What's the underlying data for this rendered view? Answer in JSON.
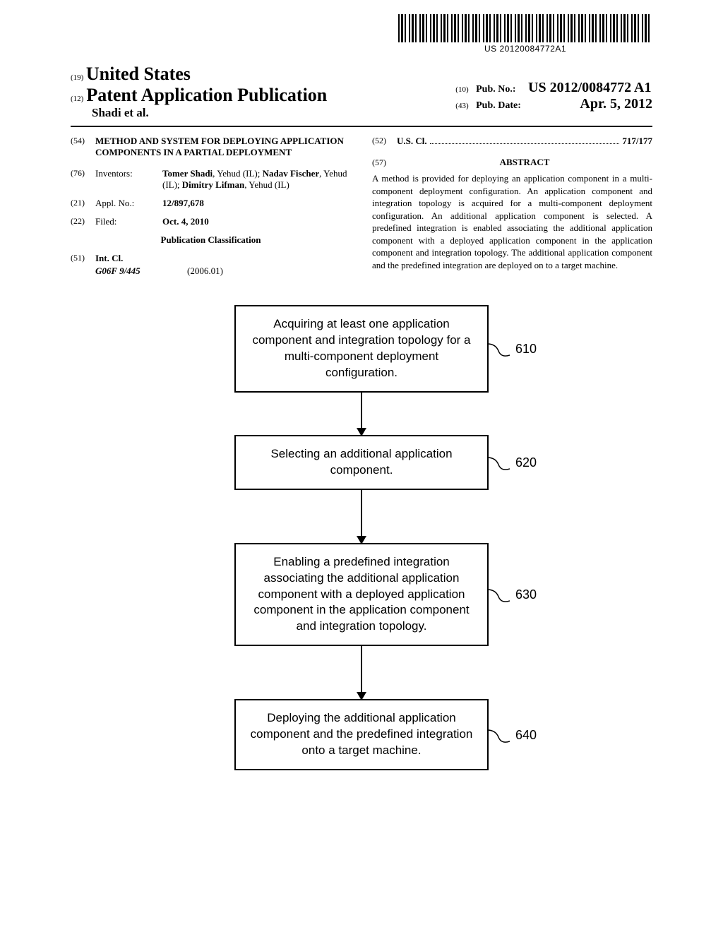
{
  "barcode_number": "US 20120084772A1",
  "header": {
    "code19": "(19)",
    "country": "United States",
    "code12": "(12)",
    "pub_type": "Patent Application Publication",
    "authors": "Shadi et al."
  },
  "right_header": {
    "code10": "(10)",
    "pub_no_label": "Pub. No.:",
    "pub_no_value": "US 2012/0084772 A1",
    "code43": "(43)",
    "pub_date_label": "Pub. Date:",
    "pub_date_value": "Apr. 5, 2012"
  },
  "left_col": {
    "code54": "(54)",
    "title": "METHOD AND SYSTEM FOR DEPLOYING APPLICATION COMPONENTS IN A PARTIAL DEPLOYMENT",
    "code76": "(76)",
    "inventors_label": "Inventors:",
    "inventors_value_1": "Tomer Shadi",
    "inventors_loc_1": ", Yehud (IL); ",
    "inventors_value_2": "Nadav Fischer",
    "inventors_loc_2": ", Yehud (IL); ",
    "inventors_value_3": "Dimitry Lifman",
    "inventors_loc_3": ", Yehud (IL)",
    "code21": "(21)",
    "appl_no_label": "Appl. No.:",
    "appl_no_value": "12/897,678",
    "code22": "(22)",
    "filed_label": "Filed:",
    "filed_value": "Oct. 4, 2010",
    "pub_class_heading": "Publication Classification",
    "code51": "(51)",
    "int_cl_label": "Int. Cl.",
    "int_cl_code": "G06F 9/445",
    "int_cl_year": "(2006.01)"
  },
  "right_col": {
    "code52": "(52)",
    "us_cl_label": "U.S. Cl.",
    "us_cl_value": "717/177",
    "code57": "(57)",
    "abstract_heading": "ABSTRACT",
    "abstract_text": "A method is provided for deploying an application component in a multi-component deployment configuration. An application component and integration topology is acquired for a multi-component deployment configuration. An additional application component is selected. A predefined integration is enabled associating the additional application component with a deployed application component in the application component and integration topology. The additional application component and the predefined integration are deployed on to a target machine."
  },
  "flowchart": {
    "box1": "Acquiring at least one application component and integration topology for a multi-component deployment configuration.",
    "label1": "610",
    "box2": "Selecting an additional application component.",
    "label2": "620",
    "box3": "Enabling a predefined integration associating the additional application component with a deployed application component in the application component and integration topology.",
    "label3": "630",
    "box4": "Deploying the additional application component and the predefined integration onto a target machine.",
    "label4": "640"
  }
}
